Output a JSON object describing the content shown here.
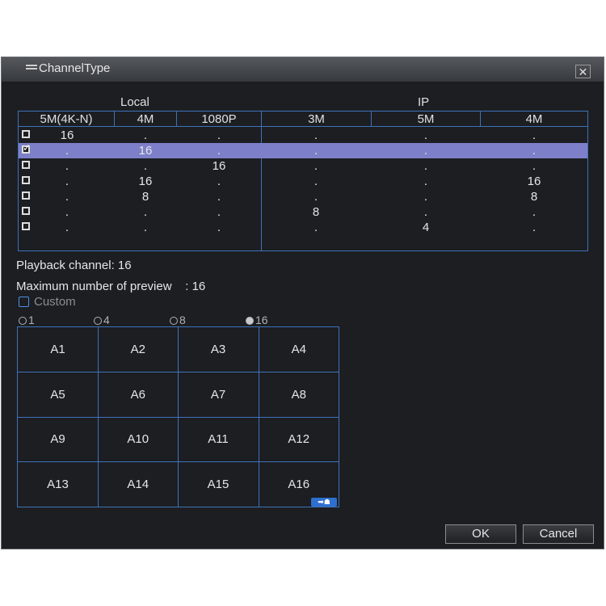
{
  "dialog": {
    "title": "ChannelType",
    "close_symbol": "✕"
  },
  "channel_table": {
    "groups": [
      "Local",
      "IP"
    ],
    "headers": [
      "5M(4K-N)",
      "4M",
      "1080P",
      "3M",
      "5M",
      "4M"
    ],
    "rows": [
      {
        "checked": false,
        "cells": [
          "16",
          ".",
          ".",
          ".",
          ".",
          "."
        ]
      },
      {
        "checked": true,
        "cells": [
          ".",
          "16",
          ".",
          ".",
          ".",
          "."
        ]
      },
      {
        "checked": false,
        "cells": [
          ".",
          ".",
          "16",
          ".",
          ".",
          "."
        ]
      },
      {
        "checked": false,
        "cells": [
          ".",
          "16",
          ".",
          ".",
          ".",
          "16"
        ]
      },
      {
        "checked": false,
        "cells": [
          ".",
          "8",
          ".",
          ".",
          ".",
          "8"
        ]
      },
      {
        "checked": false,
        "cells": [
          ".",
          ".",
          ".",
          "8",
          ".",
          "."
        ]
      },
      {
        "checked": false,
        "cells": [
          ".",
          ".",
          ".",
          ".",
          "4",
          "."
        ]
      }
    ]
  },
  "info": {
    "playback": "Playback channel: 16",
    "max_preview": "Maximum number of preview    : 16"
  },
  "custom": {
    "label": "Custom",
    "checked": false
  },
  "layout_options": [
    {
      "label": "1",
      "selected": false
    },
    {
      "label": "4",
      "selected": false
    },
    {
      "label": "8",
      "selected": false
    },
    {
      "label": "16",
      "selected": true
    }
  ],
  "preview_grid": [
    "A1",
    "A2",
    "A3",
    "A4",
    "A5",
    "A6",
    "A7",
    "A8",
    "A9",
    "A10",
    "A11",
    "A12",
    "A13",
    "A14",
    "A15",
    "A16"
  ],
  "buttons": {
    "ok": "OK",
    "cancel": "Cancel"
  },
  "icons": {
    "title": "menu-lines-icon",
    "swap": "swap-arrow-icon",
    "close": "close-icon"
  },
  "colors": {
    "grid_border": "#3f72b8",
    "row_selected": "#7d80c8",
    "background": "#1c1e22"
  }
}
